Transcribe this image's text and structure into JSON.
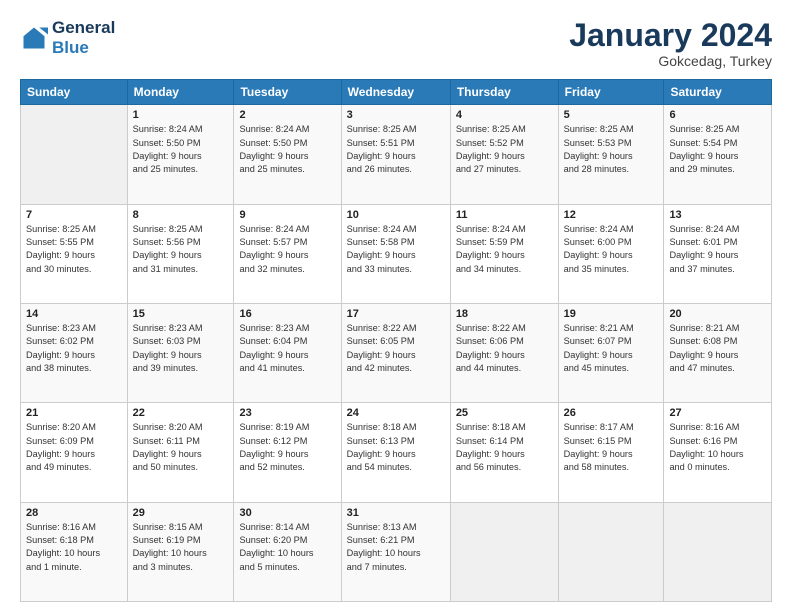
{
  "header": {
    "logo_line1": "General",
    "logo_line2": "Blue",
    "month": "January 2024",
    "location": "Gokcedag, Turkey"
  },
  "days_of_week": [
    "Sunday",
    "Monday",
    "Tuesday",
    "Wednesday",
    "Thursday",
    "Friday",
    "Saturday"
  ],
  "weeks": [
    [
      {
        "day": "",
        "info": ""
      },
      {
        "day": "1",
        "info": "Sunrise: 8:24 AM\nSunset: 5:50 PM\nDaylight: 9 hours\nand 25 minutes."
      },
      {
        "day": "2",
        "info": "Sunrise: 8:24 AM\nSunset: 5:50 PM\nDaylight: 9 hours\nand 25 minutes."
      },
      {
        "day": "3",
        "info": "Sunrise: 8:25 AM\nSunset: 5:51 PM\nDaylight: 9 hours\nand 26 minutes."
      },
      {
        "day": "4",
        "info": "Sunrise: 8:25 AM\nSunset: 5:52 PM\nDaylight: 9 hours\nand 27 minutes."
      },
      {
        "day": "5",
        "info": "Sunrise: 8:25 AM\nSunset: 5:53 PM\nDaylight: 9 hours\nand 28 minutes."
      },
      {
        "day": "6",
        "info": "Sunrise: 8:25 AM\nSunset: 5:54 PM\nDaylight: 9 hours\nand 29 minutes."
      }
    ],
    [
      {
        "day": "7",
        "info": ""
      },
      {
        "day": "8",
        "info": "Sunrise: 8:25 AM\nSunset: 5:56 PM\nDaylight: 9 hours\nand 31 minutes."
      },
      {
        "day": "9",
        "info": "Sunrise: 8:24 AM\nSunset: 5:57 PM\nDaylight: 9 hours\nand 32 minutes."
      },
      {
        "day": "10",
        "info": "Sunrise: 8:24 AM\nSunset: 5:58 PM\nDaylight: 9 hours\nand 33 minutes."
      },
      {
        "day": "11",
        "info": "Sunrise: 8:24 AM\nSunset: 5:59 PM\nDaylight: 9 hours\nand 34 minutes."
      },
      {
        "day": "12",
        "info": "Sunrise: 8:24 AM\nSunset: 6:00 PM\nDaylight: 9 hours\nand 35 minutes."
      },
      {
        "day": "13",
        "info": "Sunrise: 8:24 AM\nSunset: 6:01 PM\nDaylight: 9 hours\nand 37 minutes."
      }
    ],
    [
      {
        "day": "14",
        "info": ""
      },
      {
        "day": "15",
        "info": "Sunrise: 8:23 AM\nSunset: 6:03 PM\nDaylight: 9 hours\nand 39 minutes."
      },
      {
        "day": "16",
        "info": "Sunrise: 8:23 AM\nSunset: 6:04 PM\nDaylight: 9 hours\nand 41 minutes."
      },
      {
        "day": "17",
        "info": "Sunrise: 8:22 AM\nSunset: 6:05 PM\nDaylight: 9 hours\nand 42 minutes."
      },
      {
        "day": "18",
        "info": "Sunrise: 8:22 AM\nSunset: 6:06 PM\nDaylight: 9 hours\nand 44 minutes."
      },
      {
        "day": "19",
        "info": "Sunrise: 8:21 AM\nSunset: 6:07 PM\nDaylight: 9 hours\nand 45 minutes."
      },
      {
        "day": "20",
        "info": "Sunrise: 8:21 AM\nSunset: 6:08 PM\nDaylight: 9 hours\nand 47 minutes."
      }
    ],
    [
      {
        "day": "21",
        "info": ""
      },
      {
        "day": "22",
        "info": "Sunrise: 8:20 AM\nSunset: 6:11 PM\nDaylight: 9 hours\nand 50 minutes."
      },
      {
        "day": "23",
        "info": "Sunrise: 8:19 AM\nSunset: 6:12 PM\nDaylight: 9 hours\nand 52 minutes."
      },
      {
        "day": "24",
        "info": "Sunrise: 8:18 AM\nSunset: 6:13 PM\nDaylight: 9 hours\nand 54 minutes."
      },
      {
        "day": "25",
        "info": "Sunrise: 8:18 AM\nSunset: 6:14 PM\nDaylight: 9 hours\nand 56 minutes."
      },
      {
        "day": "26",
        "info": "Sunrise: 8:17 AM\nSunset: 6:15 PM\nDaylight: 9 hours\nand 58 minutes."
      },
      {
        "day": "27",
        "info": "Sunrise: 8:16 AM\nSunset: 6:16 PM\nDaylight: 10 hours\nand 0 minutes."
      }
    ],
    [
      {
        "day": "28",
        "info": "Sunrise: 8:16 AM\nSunset: 6:18 PM\nDaylight: 10 hours\nand 1 minute."
      },
      {
        "day": "29",
        "info": "Sunrise: 8:15 AM\nSunset: 6:19 PM\nDaylight: 10 hours\nand 3 minutes."
      },
      {
        "day": "30",
        "info": "Sunrise: 8:14 AM\nSunset: 6:20 PM\nDaylight: 10 hours\nand 5 minutes."
      },
      {
        "day": "31",
        "info": "Sunrise: 8:13 AM\nSunset: 6:21 PM\nDaylight: 10 hours\nand 7 minutes."
      },
      {
        "day": "",
        "info": ""
      },
      {
        "day": "",
        "info": ""
      },
      {
        "day": "",
        "info": ""
      }
    ]
  ],
  "week2_sunday": "Sunrise: 8:25 AM\nSunset: 5:55 PM\nDaylight: 9 hours\nand 30 minutes.",
  "week3_sunday": "Sunrise: 8:23 AM\nSunset: 6:02 PM\nDaylight: 9 hours\nand 38 minutes.",
  "week4_sunday": "Sunrise: 8:20 AM\nSunset: 6:09 PM\nDaylight: 9 hours\nand 49 minutes."
}
